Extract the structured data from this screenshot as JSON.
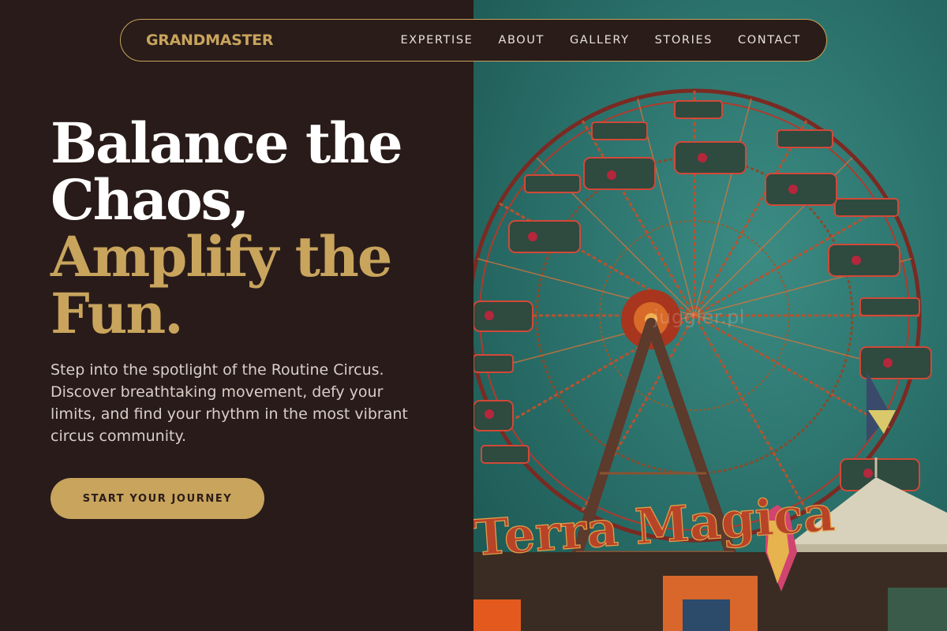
{
  "nav": {
    "brand": "GRANDMASTER",
    "links": [
      "EXPERTISE",
      "ABOUT",
      "GALLERY",
      "STORIES",
      "CONTACT"
    ]
  },
  "hero": {
    "title_lines": [
      "Balance the",
      "Chaos,",
      "Amplify the",
      "Fun."
    ],
    "description": "Step into the spotlight of the Routine Circus. Discover breathtaking movement, defy your limits, and find your rhythm in the most vibrant circus community.",
    "cta_label": "START YOUR JOURNEY"
  },
  "image": {
    "alt": "Ferris wheel at an amusement park",
    "sign_text": "Terra Magica",
    "watermark": "juggler.pl"
  },
  "colors": {
    "background": "#291b19",
    "accent_gold": "#c8a45d",
    "text_white": "#ffffff",
    "text_muted": "#d8cfc8",
    "sky_teal": "#2a7670"
  }
}
